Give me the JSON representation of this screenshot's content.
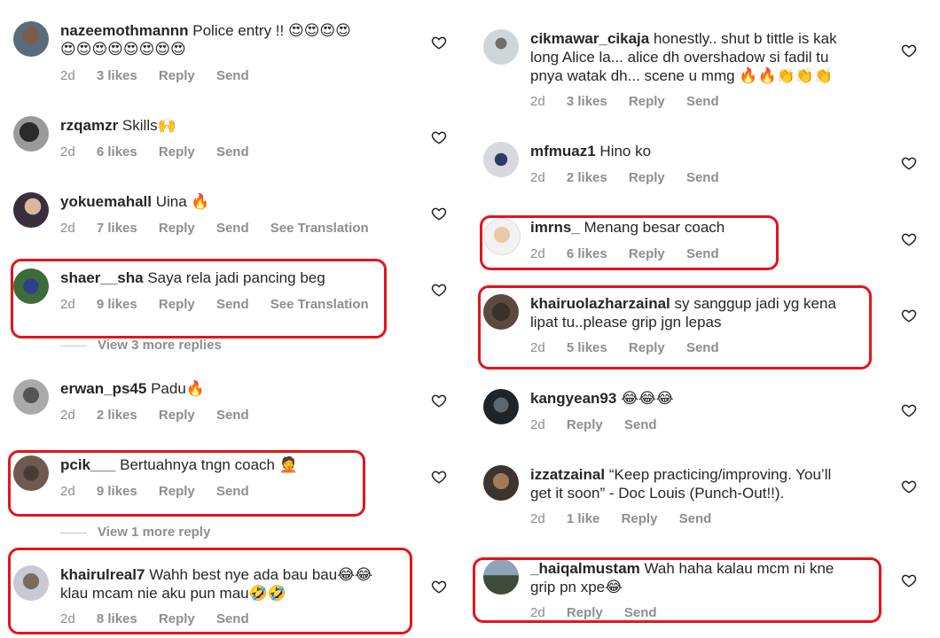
{
  "labels": {
    "reply": "Reply",
    "send": "Send",
    "see_translation": "See Translation"
  },
  "colors": {
    "highlight": "#e3141b",
    "meta": "#8e8e8e"
  },
  "left": [
    {
      "user": "nazeemothmannn",
      "text": "Police entry !! 😍😍😍😍",
      "text2": "😍😍😍😍😍😍😍😍",
      "age": "2d",
      "likes": "3 likes"
    },
    {
      "user": "rzqamzr",
      "text": "Skills🙌",
      "age": "2d",
      "likes": "6 likes"
    },
    {
      "user": "yokuemahall",
      "text": "Uina 🔥",
      "age": "2d",
      "likes": "7 likes"
    },
    {
      "user": "shaer__sha",
      "text": "Saya rela jadi pancing beg",
      "age": "2d",
      "likes": "9 likes",
      "view_more": "View 3 more replies"
    },
    {
      "user": "erwan_ps45",
      "text": "Padu🔥",
      "age": "2d",
      "likes": "2 likes"
    },
    {
      "user": "pcik___",
      "text": "Bertuahnya tngn coach 🤦",
      "age": "2d",
      "likes": "9 likes",
      "view_more": "View 1 more reply"
    },
    {
      "user": "khairulreal7",
      "text": "Wahh best nye ada bau bau😂😂",
      "text2": "klau mcam nie aku pun mau🤣🤣",
      "age": "2d",
      "likes": "8 likes"
    }
  ],
  "right": [
    {
      "user": "cikmawar_cikaja",
      "text": "honestly.. shut b tittle is kak",
      "text2": "long Alice la... alice dh overshadow si fadil tu",
      "text3": "pnya watak dh... scene u mmg 🔥🔥👏👏👏",
      "age": "2d",
      "likes": "3 likes"
    },
    {
      "user": "mfmuaz1",
      "text": "Hino ko",
      "age": "2d",
      "likes": "2 likes"
    },
    {
      "user": "imrns_",
      "text": "Menang besar coach",
      "age": "2d",
      "likes": "6 likes"
    },
    {
      "user": "khairuolazharzainal",
      "text": "sy sanggup jadi yg kena",
      "text2": "lipat tu..please grip jgn lepas",
      "age": "2d",
      "likes": "5 likes"
    },
    {
      "user": "kangyean93",
      "text": "😂😂😂",
      "age": "2d"
    },
    {
      "user": "izzatzainal",
      "text": "“Keep practicing/improving. You’ll",
      "text2": "get it soon” - Doc Louis (Punch-Out!!).",
      "age": "2d",
      "likes": "1 like"
    },
    {
      "user": "_haiqalmustam",
      "text": "Wah haha kalau mcm ni kne",
      "text2": "grip pn xpe😂",
      "age": "2d"
    }
  ]
}
